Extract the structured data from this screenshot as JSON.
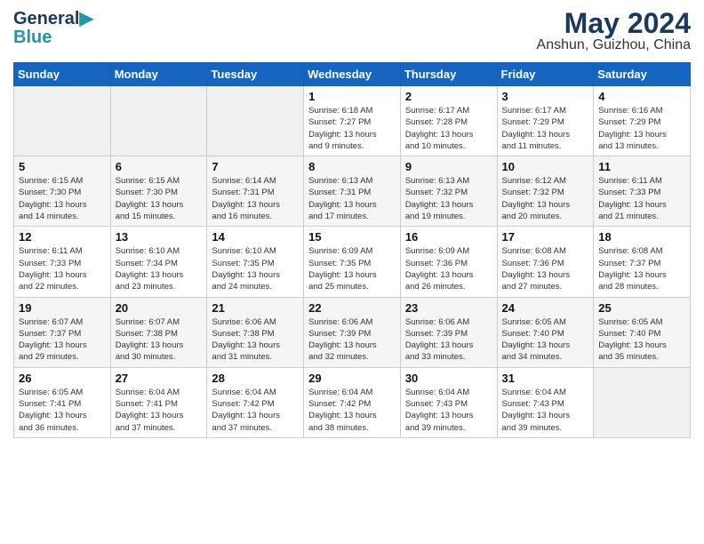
{
  "header": {
    "logo_line1": "General",
    "logo_line2": "Blue",
    "title": "May 2024",
    "subtitle": "Anshun, Guizhou, China"
  },
  "days_of_week": [
    "Sunday",
    "Monday",
    "Tuesday",
    "Wednesday",
    "Thursday",
    "Friday",
    "Saturday"
  ],
  "weeks": [
    [
      {
        "day": "",
        "info": ""
      },
      {
        "day": "",
        "info": ""
      },
      {
        "day": "",
        "info": ""
      },
      {
        "day": "1",
        "info": "Sunrise: 6:18 AM\nSunset: 7:27 PM\nDaylight: 13 hours\nand 9 minutes."
      },
      {
        "day": "2",
        "info": "Sunrise: 6:17 AM\nSunset: 7:28 PM\nDaylight: 13 hours\nand 10 minutes."
      },
      {
        "day": "3",
        "info": "Sunrise: 6:17 AM\nSunset: 7:29 PM\nDaylight: 13 hours\nand 11 minutes."
      },
      {
        "day": "4",
        "info": "Sunrise: 6:16 AM\nSunset: 7:29 PM\nDaylight: 13 hours\nand 13 minutes."
      }
    ],
    [
      {
        "day": "5",
        "info": "Sunrise: 6:15 AM\nSunset: 7:30 PM\nDaylight: 13 hours\nand 14 minutes."
      },
      {
        "day": "6",
        "info": "Sunrise: 6:15 AM\nSunset: 7:30 PM\nDaylight: 13 hours\nand 15 minutes."
      },
      {
        "day": "7",
        "info": "Sunrise: 6:14 AM\nSunset: 7:31 PM\nDaylight: 13 hours\nand 16 minutes."
      },
      {
        "day": "8",
        "info": "Sunrise: 6:13 AM\nSunset: 7:31 PM\nDaylight: 13 hours\nand 17 minutes."
      },
      {
        "day": "9",
        "info": "Sunrise: 6:13 AM\nSunset: 7:32 PM\nDaylight: 13 hours\nand 19 minutes."
      },
      {
        "day": "10",
        "info": "Sunrise: 6:12 AM\nSunset: 7:32 PM\nDaylight: 13 hours\nand 20 minutes."
      },
      {
        "day": "11",
        "info": "Sunrise: 6:11 AM\nSunset: 7:33 PM\nDaylight: 13 hours\nand 21 minutes."
      }
    ],
    [
      {
        "day": "12",
        "info": "Sunrise: 6:11 AM\nSunset: 7:33 PM\nDaylight: 13 hours\nand 22 minutes."
      },
      {
        "day": "13",
        "info": "Sunrise: 6:10 AM\nSunset: 7:34 PM\nDaylight: 13 hours\nand 23 minutes."
      },
      {
        "day": "14",
        "info": "Sunrise: 6:10 AM\nSunset: 7:35 PM\nDaylight: 13 hours\nand 24 minutes."
      },
      {
        "day": "15",
        "info": "Sunrise: 6:09 AM\nSunset: 7:35 PM\nDaylight: 13 hours\nand 25 minutes."
      },
      {
        "day": "16",
        "info": "Sunrise: 6:09 AM\nSunset: 7:36 PM\nDaylight: 13 hours\nand 26 minutes."
      },
      {
        "day": "17",
        "info": "Sunrise: 6:08 AM\nSunset: 7:36 PM\nDaylight: 13 hours\nand 27 minutes."
      },
      {
        "day": "18",
        "info": "Sunrise: 6:08 AM\nSunset: 7:37 PM\nDaylight: 13 hours\nand 28 minutes."
      }
    ],
    [
      {
        "day": "19",
        "info": "Sunrise: 6:07 AM\nSunset: 7:37 PM\nDaylight: 13 hours\nand 29 minutes."
      },
      {
        "day": "20",
        "info": "Sunrise: 6:07 AM\nSunset: 7:38 PM\nDaylight: 13 hours\nand 30 minutes."
      },
      {
        "day": "21",
        "info": "Sunrise: 6:06 AM\nSunset: 7:38 PM\nDaylight: 13 hours\nand 31 minutes."
      },
      {
        "day": "22",
        "info": "Sunrise: 6:06 AM\nSunset: 7:39 PM\nDaylight: 13 hours\nand 32 minutes."
      },
      {
        "day": "23",
        "info": "Sunrise: 6:06 AM\nSunset: 7:39 PM\nDaylight: 13 hours\nand 33 minutes."
      },
      {
        "day": "24",
        "info": "Sunrise: 6:05 AM\nSunset: 7:40 PM\nDaylight: 13 hours\nand 34 minutes."
      },
      {
        "day": "25",
        "info": "Sunrise: 6:05 AM\nSunset: 7:40 PM\nDaylight: 13 hours\nand 35 minutes."
      }
    ],
    [
      {
        "day": "26",
        "info": "Sunrise: 6:05 AM\nSunset: 7:41 PM\nDaylight: 13 hours\nand 36 minutes."
      },
      {
        "day": "27",
        "info": "Sunrise: 6:04 AM\nSunset: 7:41 PM\nDaylight: 13 hours\nand 37 minutes."
      },
      {
        "day": "28",
        "info": "Sunrise: 6:04 AM\nSunset: 7:42 PM\nDaylight: 13 hours\nand 37 minutes."
      },
      {
        "day": "29",
        "info": "Sunrise: 6:04 AM\nSunset: 7:42 PM\nDaylight: 13 hours\nand 38 minutes."
      },
      {
        "day": "30",
        "info": "Sunrise: 6:04 AM\nSunset: 7:43 PM\nDaylight: 13 hours\nand 39 minutes."
      },
      {
        "day": "31",
        "info": "Sunrise: 6:04 AM\nSunset: 7:43 PM\nDaylight: 13 hours\nand 39 minutes."
      },
      {
        "day": "",
        "info": ""
      }
    ]
  ]
}
